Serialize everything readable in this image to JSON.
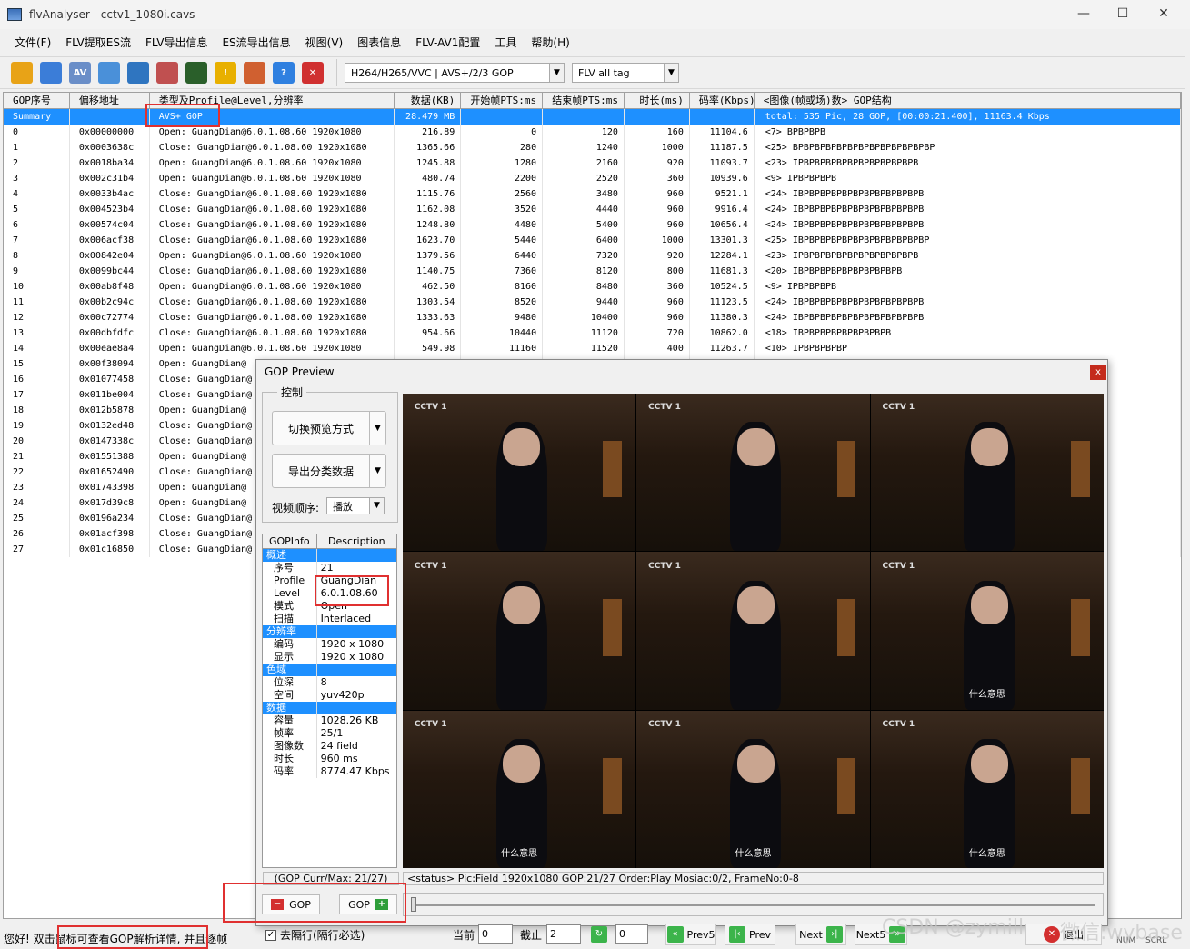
{
  "window": {
    "title": "flvAnalyser - cctv1_1080i.cavs",
    "minimize": "—",
    "maximize": "☐",
    "close": "✕"
  },
  "menu": [
    "文件(F)",
    "FLV提取ES流",
    "FLV导出信息",
    "ES流导出信息",
    "视图(V)",
    "图表信息",
    "FLV-AV1配置",
    "工具",
    "帮助(H)"
  ],
  "toolbar": {
    "icons": [
      {
        "name": "open-folder-icon",
        "color": "#e8a317"
      },
      {
        "name": "network-icon",
        "color": "#3b7dd8"
      },
      {
        "name": "av-icon",
        "color": "#6a8ec8",
        "text": "AV"
      },
      {
        "name": "grid-icon",
        "color": "#4a90d9"
      },
      {
        "name": "clock-icon",
        "color": "#2f75c0"
      },
      {
        "name": "line-chart-icon",
        "color": "#c05050"
      },
      {
        "name": "waveform-icon",
        "color": "#2a5f2a"
      },
      {
        "name": "warning-icon",
        "color": "#e8b000",
        "text": "!"
      },
      {
        "name": "user-icon",
        "color": "#d06030"
      },
      {
        "name": "help-icon",
        "color": "#2f80e0",
        "text": "?"
      },
      {
        "name": "stop-icon",
        "color": "#d03030",
        "text": "✕"
      }
    ],
    "codec_select": "H264/H265/VVC | AVS+/2/3 GOP",
    "tag_select": "FLV all tag"
  },
  "grid": {
    "headers": [
      "GOP序号",
      "偏移地址",
      "类型及Profile@Level,分辨率",
      "数据(KB)",
      "开始帧PTS:ms",
      "结束帧PTS:ms",
      "时长(ms)",
      "码率(Kbps)",
      "<图像(帧或场)数> GOP结构"
    ],
    "summary": {
      "c0": "Summary",
      "c1": "",
      "c2": "AVS+ GOP",
      "c3": "28.479 MB",
      "c4": "",
      "c5": "",
      "c6": "",
      "c7": "",
      "c8": "total: 535 Pic, 28 GOP, [00:00:21.400], 11163.4 Kbps"
    },
    "rows": [
      {
        "c0": "0",
        "c1": "0x00000000",
        "c2": "Open: GuangDian@6.0.1.08.60  1920x1080",
        "c3": "216.89",
        "c4": "0",
        "c5": "120",
        "c6": "160",
        "c7": "11104.6",
        "c8": "<7> BPBPBPB"
      },
      {
        "c0": "1",
        "c1": "0x0003638c",
        "c2": "Close: GuangDian@6.0.1.08.60  1920x1080",
        "c3": "1365.66",
        "c4": "280",
        "c5": "1240",
        "c6": "1000",
        "c7": "11187.5",
        "c8": "<25> BPBPBPBPBPBPBPBPBPBPBPBPBP"
      },
      {
        "c0": "2",
        "c1": "0x0018ba34",
        "c2": "Open: GuangDian@6.0.1.08.60  1920x1080",
        "c3": "1245.88",
        "c4": "1280",
        "c5": "2160",
        "c6": "920",
        "c7": "11093.7",
        "c8": "<23> IPBPBPBPBPBPBPBPBPBPBPB"
      },
      {
        "c0": "3",
        "c1": "0x002c31b4",
        "c2": "Open: GuangDian@6.0.1.08.60  1920x1080",
        "c3": "480.74",
        "c4": "2200",
        "c5": "2520",
        "c6": "360",
        "c7": "10939.6",
        "c8": "<9> IPBPBPBPB"
      },
      {
        "c0": "4",
        "c1": "0x0033b4ac",
        "c2": "Close: GuangDian@6.0.1.08.60  1920x1080",
        "c3": "1115.76",
        "c4": "2560",
        "c5": "3480",
        "c6": "960",
        "c7": "9521.1",
        "c8": "<24> IBPBPBPBPBPBPBPBPBPBPBPB"
      },
      {
        "c0": "5",
        "c1": "0x004523b4",
        "c2": "Close: GuangDian@6.0.1.08.60  1920x1080",
        "c3": "1162.08",
        "c4": "3520",
        "c5": "4440",
        "c6": "960",
        "c7": "9916.4",
        "c8": "<24> IBPBPBPBPBPBPBPBPBPBPBPB"
      },
      {
        "c0": "6",
        "c1": "0x00574c04",
        "c2": "Close: GuangDian@6.0.1.08.60  1920x1080",
        "c3": "1248.80",
        "c4": "4480",
        "c5": "5400",
        "c6": "960",
        "c7": "10656.4",
        "c8": "<24> IBPBPBPBPBPBPBPBPBPBPBPB"
      },
      {
        "c0": "7",
        "c1": "0x006acf38",
        "c2": "Close: GuangDian@6.0.1.08.60  1920x1080",
        "c3": "1623.70",
        "c4": "5440",
        "c5": "6400",
        "c6": "1000",
        "c7": "13301.3",
        "c8": "<25> IBPBPBPBPBPBPBPBPBPBPBPBP"
      },
      {
        "c0": "8",
        "c1": "0x00842e04",
        "c2": "Open: GuangDian@6.0.1.08.60  1920x1080",
        "c3": "1379.56",
        "c4": "6440",
        "c5": "7320",
        "c6": "920",
        "c7": "12284.1",
        "c8": "<23> IPBPBPBPBPBPBPBPBPBPBPB"
      },
      {
        "c0": "9",
        "c1": "0x0099bc44",
        "c2": "Close: GuangDian@6.0.1.08.60  1920x1080",
        "c3": "1140.75",
        "c4": "7360",
        "c5": "8120",
        "c6": "800",
        "c7": "11681.3",
        "c8": "<20> IBPBPBPBPBPBPBPBPBPB"
      },
      {
        "c0": "10",
        "c1": "0x00ab8f48",
        "c2": "Open: GuangDian@6.0.1.08.60  1920x1080",
        "c3": "462.50",
        "c4": "8160",
        "c5": "8480",
        "c6": "360",
        "c7": "10524.5",
        "c8": "<9> IPBPBPBPB"
      },
      {
        "c0": "11",
        "c1": "0x00b2c94c",
        "c2": "Close: GuangDian@6.0.1.08.60  1920x1080",
        "c3": "1303.54",
        "c4": "8520",
        "c5": "9440",
        "c6": "960",
        "c7": "11123.5",
        "c8": "<24> IBPBPBPBPBPBPBPBPBPBPBPB"
      },
      {
        "c0": "12",
        "c1": "0x00c72774",
        "c2": "Close: GuangDian@6.0.1.08.60  1920x1080",
        "c3": "1333.63",
        "c4": "9480",
        "c5": "10400",
        "c6": "960",
        "c7": "11380.3",
        "c8": "<24> IBPBPBPBPBPBPBPBPBPBPBPB"
      },
      {
        "c0": "13",
        "c1": "0x00dbfdfc",
        "c2": "Close: GuangDian@6.0.1.08.60  1920x1080",
        "c3": "954.66",
        "c4": "10440",
        "c5": "11120",
        "c6": "720",
        "c7": "10862.0",
        "c8": "<18> IBPBPBPBPBPBPBPBPB"
      },
      {
        "c0": "14",
        "c1": "0x00eae8a4",
        "c2": "Open: GuangDian@6.0.1.08.60  1920x1080",
        "c3": "549.98",
        "c4": "11160",
        "c5": "11520",
        "c6": "400",
        "c7": "11263.7",
        "c8": "<10> IPBPBPBPBP"
      },
      {
        "c0": "15",
        "c1": "0x00f38094",
        "c2": "Open: GuangDian@",
        "c3": "",
        "c4": "",
        "c5": "",
        "c6": "",
        "c7": "",
        "c8": ""
      },
      {
        "c0": "16",
        "c1": "0x01077458",
        "c2": "Close: GuangDian@",
        "c3": "",
        "c4": "",
        "c5": "",
        "c6": "",
        "c7": "",
        "c8": ""
      },
      {
        "c0": "17",
        "c1": "0x011be004",
        "c2": "Close: GuangDian@",
        "c3": "",
        "c4": "",
        "c5": "",
        "c6": "",
        "c7": "",
        "c8": ""
      },
      {
        "c0": "18",
        "c1": "0x012b5878",
        "c2": "Open: GuangDian@",
        "c3": "",
        "c4": "",
        "c5": "",
        "c6": "",
        "c7": "",
        "c8": ""
      },
      {
        "c0": "19",
        "c1": "0x0132ed48",
        "c2": "Close: GuangDian@",
        "c3": "",
        "c4": "",
        "c5": "",
        "c6": "",
        "c7": "",
        "c8": ""
      },
      {
        "c0": "20",
        "c1": "0x0147338c",
        "c2": "Close: GuangDian@",
        "c3": "",
        "c4": "",
        "c5": "",
        "c6": "",
        "c7": "",
        "c8": ""
      },
      {
        "c0": "21",
        "c1": "0x01551388",
        "c2": "Open: GuangDian@",
        "c3": "",
        "c4": "",
        "c5": "",
        "c6": "",
        "c7": "",
        "c8": ""
      },
      {
        "c0": "22",
        "c1": "0x01652490",
        "c2": "Close: GuangDian@",
        "c3": "",
        "c4": "",
        "c5": "",
        "c6": "",
        "c7": "",
        "c8": ""
      },
      {
        "c0": "23",
        "c1": "0x01743398",
        "c2": "Open: GuangDian@",
        "c3": "",
        "c4": "",
        "c5": "",
        "c6": "",
        "c7": "",
        "c8": ""
      },
      {
        "c0": "24",
        "c1": "0x017d39c8",
        "c2": "Open: GuangDian@",
        "c3": "",
        "c4": "",
        "c5": "",
        "c6": "",
        "c7": "",
        "c8": ""
      },
      {
        "c0": "25",
        "c1": "0x0196a234",
        "c2": "Close: GuangDian@",
        "c3": "",
        "c4": "",
        "c5": "",
        "c6": "",
        "c7": "",
        "c8": ""
      },
      {
        "c0": "26",
        "c1": "0x01acf398",
        "c2": "Close: GuangDian@",
        "c3": "",
        "c4": "",
        "c5": "",
        "c6": "",
        "c7": "",
        "c8": ""
      },
      {
        "c0": "27",
        "c1": "0x01c16850",
        "c2": "Close: GuangDian@",
        "c3": "",
        "c4": "",
        "c5": "",
        "c6": "",
        "c7": "",
        "c8": ""
      }
    ]
  },
  "dialog": {
    "title": "GOP Preview",
    "close": "x",
    "group_label": "控制",
    "switch_preview": "切换预览方式",
    "export_data": "导出分类数据",
    "order_label": "视频顺序:",
    "order_value": "播放",
    "info_headers": [
      "GOPInfo",
      "Description"
    ],
    "info_rows": [
      {
        "k": "概述",
        "v": "",
        "section": true
      },
      {
        "k": "序号",
        "v": "21"
      },
      {
        "k": "Profile",
        "v": "GuangDian"
      },
      {
        "k": "Level",
        "v": "6.0.1.08.60"
      },
      {
        "k": "模式",
        "v": "Open"
      },
      {
        "k": "扫描",
        "v": "Interlaced"
      },
      {
        "k": "分辨率",
        "v": "",
        "section": true
      },
      {
        "k": "编码",
        "v": "1920 x 1080"
      },
      {
        "k": "显示",
        "v": "1920 x 1080"
      },
      {
        "k": "色域",
        "v": "",
        "section": true
      },
      {
        "k": "位深",
        "v": "8"
      },
      {
        "k": "空间",
        "v": "yuv420p"
      },
      {
        "k": "数据",
        "v": "",
        "section": true
      },
      {
        "k": "容量",
        "v": "1028.26 KB"
      },
      {
        "k": "帧率",
        "v": "25/1"
      },
      {
        "k": "图像数",
        "v": "24 field"
      },
      {
        "k": "时长",
        "v": "960 ms"
      },
      {
        "k": "码率",
        "v": "8774.47 Kbps"
      }
    ],
    "gop_curr": "(GOP Curr/Max: 21/27)",
    "status": "<status> Pic:Field  1920x1080  GOP:21/27 Order:Play Mosiac:0/2, FrameNo:0-8",
    "prev_gop": "GOP",
    "next_gop": "GOP",
    "frames": [
      {
        "logo": "CCTV 1",
        "side": "",
        "sub": ""
      },
      {
        "logo": "CCTV 1",
        "side": "",
        "sub": ""
      },
      {
        "logo": "CCTV 1",
        "side": "",
        "sub": ""
      },
      {
        "logo": "CCTV 1",
        "side": "",
        "sub": ""
      },
      {
        "logo": "CCTV 1",
        "side": "",
        "sub": ""
      },
      {
        "logo": "CCTV 1",
        "side": "",
        "sub": "什么意思"
      },
      {
        "logo": "CCTV 1",
        "side": "",
        "sub": "什么意思"
      },
      {
        "logo": "CCTV 1",
        "side": "",
        "sub": "什么意思"
      },
      {
        "logo": "CCTV 1",
        "side": "",
        "sub": "什么意思"
      }
    ]
  },
  "bottom": {
    "status": "您好! 双击鼠标可查看GOP解析详情, 并且逐帧",
    "deinterlace": "去隔行(隔行必选)",
    "current_label": "当前",
    "current_value": "0",
    "cut_label": "截止",
    "cut_value": "2",
    "step_value": "0",
    "prev5": "Prev5",
    "prev": "Prev",
    "next": "Next",
    "next5": "Next5",
    "exit": "退出",
    "num": "NUM",
    "scrl": "SCRL",
    "watermark": "CSDN @zymill",
    "watermark2": "微信:wybase"
  }
}
